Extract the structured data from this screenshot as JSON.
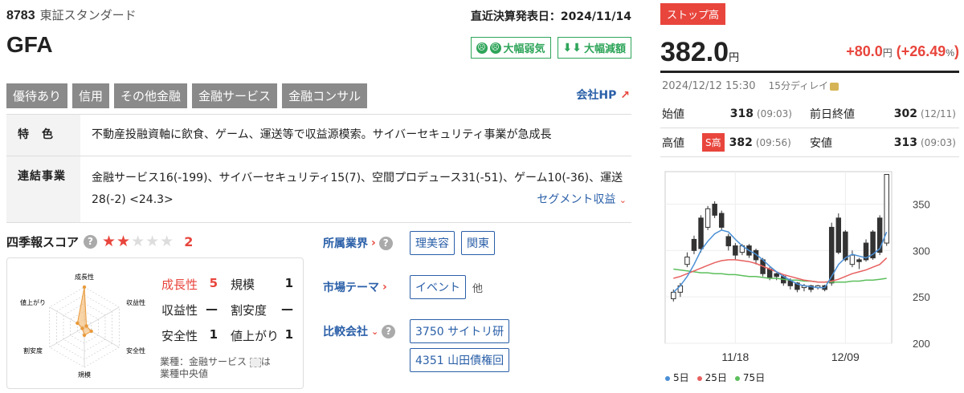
{
  "stock": {
    "code": "8783",
    "market": "東証スタンダード",
    "name": "GFA",
    "kessan": "直近決算発表日：2024/11/14",
    "badge_sentiment": "大幅弱気",
    "badge_revision": "大幅減額",
    "tags": [
      "優待あり",
      "信用",
      "その他金融",
      "金融サービス",
      "金融コンサル"
    ],
    "company_hp": "会社HP"
  },
  "features": {
    "label_tokushoku": "特　色",
    "tokushoku": "不動産投融資軸に飲食、ゲーム、運送等で収益源模索。サイバーセキュリティ事業が急成長",
    "label_renketsu": "連結事業",
    "renketsu": "金融サービス16(-199)、サイバーセキュリティ15(7)、空間プロデュース31(-51)、ゲーム10(-36)、運送28(-2) <24.3>",
    "segment_link": "セグメント収益"
  },
  "score": {
    "title": "四季報スコア",
    "value": "2",
    "stars_on": "★★",
    "stars_off": "★★★",
    "radar_labels": [
      "成長性",
      "収益性",
      "安全性",
      "規模",
      "割安度",
      "値上がり"
    ],
    "metrics": [
      {
        "l1": "成長性",
        "v1": "5",
        "l2": "規模",
        "v2": "1"
      },
      {
        "l1": "収益性",
        "v1": "—",
        "l2": "割安度",
        "v2": "—"
      },
      {
        "l1": "安全性",
        "v1": "1",
        "l2": "値上がり",
        "v2": "1"
      }
    ],
    "note_line1": "業種：金融サービス",
    "note_line1b": "は",
    "note_line2": "業種中央値",
    "radar_values": [
      5,
      0,
      1,
      1,
      0,
      1
    ]
  },
  "info": {
    "industry_label": "所属業界",
    "industry": [
      "理美容",
      "関東"
    ],
    "theme_label": "市場テーマ",
    "theme": [
      "イベント"
    ],
    "theme_more": "他",
    "compare_label": "比較会社",
    "compare": [
      "3750 サイトリ研",
      "4351 山田債権回"
    ]
  },
  "quote": {
    "stop_badge": "ストップ高",
    "price": "382.0",
    "yen": "円",
    "change": "+80.0",
    "change_pct": "+26.49",
    "pct_sign": "%",
    "open_paren": "(",
    "close_paren": ")",
    "datetime": "2024/12/12 15:30",
    "delay": "15分ディレイ",
    "open_label": "始値",
    "open": "318",
    "open_time": "(09:03)",
    "prev_label": "前日終値",
    "prev": "302",
    "prev_time": "(12/11)",
    "high_label": "高値",
    "high_badge": "S高",
    "high": "382",
    "high_time": "(09:56)",
    "low_label": "安値",
    "low": "313",
    "low_time": "(09:03)"
  },
  "chart_data": {
    "type": "candlestick",
    "y_ticks": [
      "350",
      "300",
      "250",
      "200"
    ],
    "ylim": [
      200,
      385
    ],
    "x_ticks": [
      "11/18",
      "12/09"
    ],
    "candles": [
      [
        248,
        255,
        245,
        258
      ],
      [
        255,
        262,
        250,
        265
      ],
      [
        285,
        293,
        282,
        298
      ],
      [
        312,
        300,
        296,
        316
      ],
      [
        335,
        302,
        298,
        338
      ],
      [
        325,
        345,
        322,
        348
      ],
      [
        350,
        338,
        335,
        353
      ],
      [
        340,
        325,
        322,
        343
      ],
      [
        315,
        305,
        300,
        318
      ],
      [
        305,
        295,
        290,
        308
      ],
      [
        298,
        305,
        295,
        307
      ],
      [
        305,
        295,
        292,
        307
      ],
      [
        300,
        290,
        285,
        302
      ],
      [
        290,
        275,
        272,
        292
      ],
      [
        280,
        270,
        268,
        282
      ],
      [
        275,
        272,
        268,
        276
      ],
      [
        272,
        265,
        262,
        274
      ],
      [
        268,
        262,
        258,
        270
      ],
      [
        265,
        258,
        255,
        266
      ],
      [
        260,
        262,
        256,
        264
      ],
      [
        262,
        258,
        255,
        263
      ],
      [
        260,
        262,
        258,
        263
      ],
      [
        262,
        258,
        256,
        263
      ],
      [
        325,
        265,
        262,
        330
      ],
      [
        335,
        298,
        296,
        340
      ],
      [
        320,
        290,
        288,
        322
      ],
      [
        285,
        295,
        282,
        300
      ],
      [
        290,
        288,
        280,
        292
      ],
      [
        308,
        290,
        288,
        312
      ],
      [
        320,
        292,
        290,
        322
      ],
      [
        335,
        298,
        295,
        338
      ],
      [
        308,
        382,
        305,
        382
      ]
    ],
    "ma5": [
      255,
      262,
      272,
      285,
      300,
      310,
      318,
      322,
      320,
      312,
      305,
      300,
      296,
      290,
      283,
      277,
      272,
      268,
      264,
      262,
      261,
      260,
      260,
      272,
      285,
      292,
      296,
      294,
      292,
      296,
      302,
      320
    ],
    "ma25": [
      270,
      272,
      275,
      278,
      281,
      284,
      287,
      289,
      290,
      290,
      289,
      288,
      286,
      283,
      280,
      277,
      274,
      272,
      270,
      268,
      267,
      266,
      266,
      267,
      269,
      272,
      275,
      277,
      279,
      282,
      285,
      292
    ],
    "ma75": [
      280,
      279,
      278,
      277,
      276,
      276,
      275,
      275,
      274,
      274,
      273,
      272,
      272,
      271,
      270,
      270,
      269,
      268,
      268,
      267,
      267,
      266,
      266,
      266,
      266,
      266,
      267,
      267,
      268,
      268,
      269,
      270
    ],
    "legend": [
      "5日",
      "25日",
      "75日"
    ]
  },
  "colors": {
    "up": "#e8453c",
    "accent_blue": "#2a5fa8",
    "bearish_green": "#2fa55a",
    "ma5": "#4a8fd6",
    "ma25": "#e86060",
    "ma75": "#5cbf5c",
    "radar_fill": "#f5b76a"
  }
}
